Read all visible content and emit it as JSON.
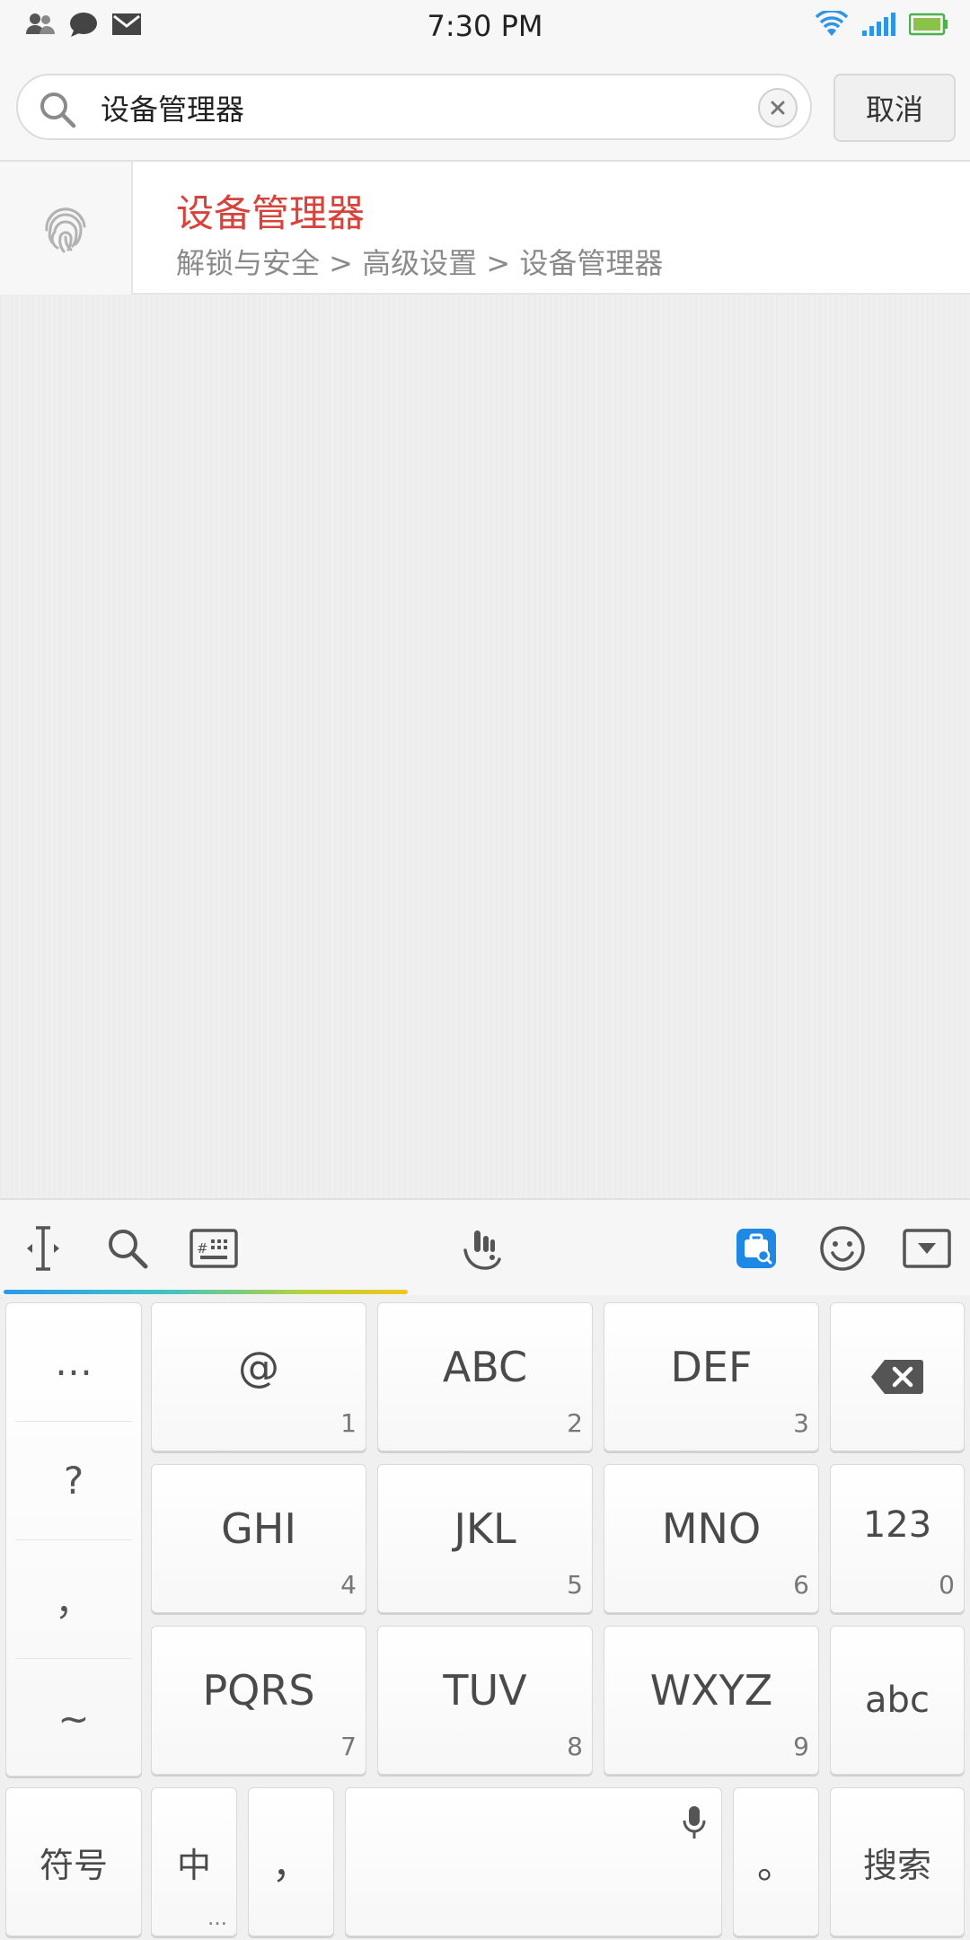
{
  "status_bar": {
    "time": "7:30 PM",
    "left_icons": [
      "contacts-icon",
      "chat-bubble-icon",
      "mail-icon"
    ],
    "right_icons": [
      "wifi-icon",
      "signal-icon",
      "battery-icon"
    ]
  },
  "search": {
    "query": "设备管理器",
    "cancel_label": "取消"
  },
  "result": {
    "title": "设备管理器",
    "path": "解锁与安全 > 高级设置 > 设备管理器",
    "icon": "fingerprint-icon",
    "title_color": "#d6433b"
  },
  "keyboard_toolbar": {
    "icons": [
      "cursor-icon",
      "search-icon",
      "keypad-icon",
      "handwriting-icon",
      "toolbox-icon",
      "emoji-icon",
      "hide-keyboard-icon"
    ]
  },
  "keyboard": {
    "symbols": [
      "…",
      "?",
      "，",
      "~"
    ],
    "keys": [
      {
        "label": "@",
        "digit": "1"
      },
      {
        "label": "ABC",
        "digit": "2"
      },
      {
        "label": "DEF",
        "digit": "3"
      },
      {
        "label": "GHI",
        "digit": "4"
      },
      {
        "label": "JKL",
        "digit": "5"
      },
      {
        "label": "MNO",
        "digit": "6"
      },
      {
        "label": "PQRS",
        "digit": "7"
      },
      {
        "label": "TUV",
        "digit": "8"
      },
      {
        "label": "WXYZ",
        "digit": "9"
      }
    ],
    "numeric_key": {
      "label": "123",
      "digit": "0"
    },
    "abc_label": "abc",
    "symbol_label": "符号",
    "chinese_label": "中",
    "chinese_sub": "…",
    "comma_label": "，",
    "period_label": "。",
    "search_label": "搜索"
  }
}
